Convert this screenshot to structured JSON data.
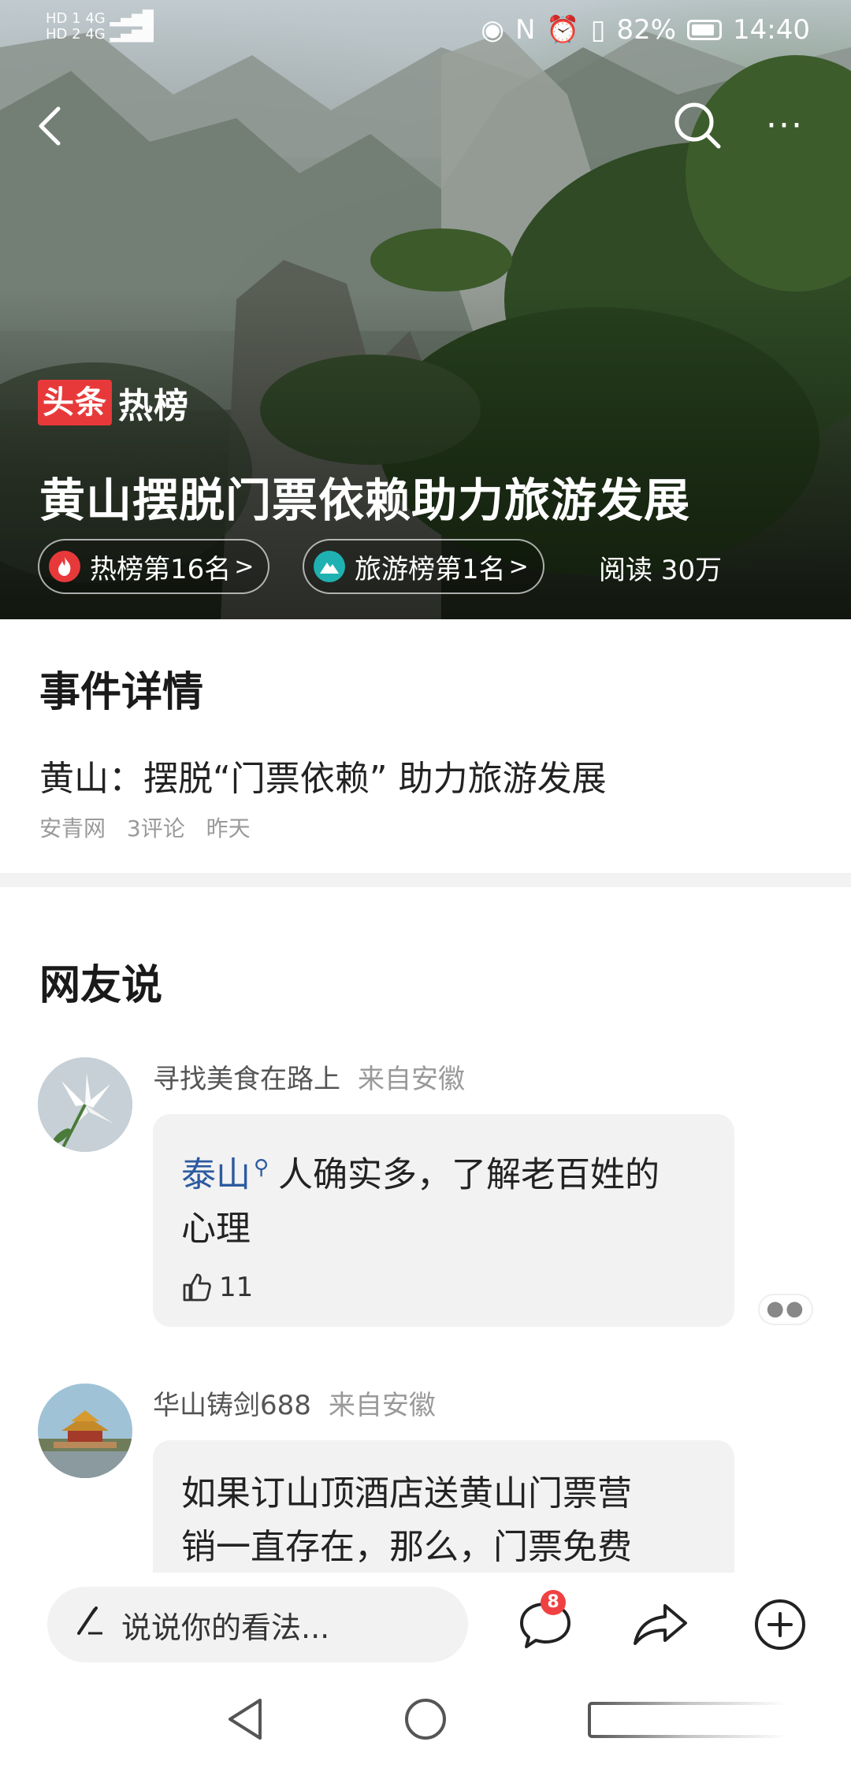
{
  "status_bar": {
    "left_lines": [
      "HD 1",
      "HD 2"
    ],
    "network": [
      "4G",
      "4G"
    ],
    "battery": "82%",
    "time": "14:40"
  },
  "top_bar": {
    "back_icon": "chevron-left-icon",
    "search_icon": "search-icon",
    "more_icon": "more-dots-icon",
    "more_label": "···"
  },
  "hero": {
    "brand_red": "头条",
    "brand_white": "热榜",
    "title": "黄山摆脱门票依赖助力旅游发展",
    "chips": [
      {
        "label": "热榜第16名",
        "arrow": ">",
        "icon": "fire-icon",
        "color": "#e8393a"
      },
      {
        "label": "旅游榜第1名",
        "arrow": ">",
        "icon": "mountain-icon",
        "color": "#1fb1b1"
      }
    ],
    "read_count": "阅读 30万"
  },
  "event": {
    "section_title": "事件详情",
    "headline": "黄山：摆脱“门票依赖” 助力旅游发展",
    "source": "安青网",
    "comments": "3评论",
    "time": "昨天"
  },
  "netizens": {
    "section_title": "网友说",
    "comments": [
      {
        "user": "寻找美食在路上",
        "location": "来自安徽",
        "keyword": "泰山",
        "text_line1": "人确实多，了解老百姓的",
        "text_line2": "心理",
        "likes": "11"
      },
      {
        "user": "华山铸剑688",
        "location": "来自安徽",
        "text_line1": "如果订山顶酒店送黄山门票营",
        "text_line2": "销一直存在，那么，门票免费"
      }
    ]
  },
  "action_bar": {
    "input_placeholder": "说说你的看法...",
    "comment_badge": "8",
    "icons": [
      "comment-icon",
      "share-icon",
      "add-icon"
    ]
  },
  "nav_bar": {
    "icons": [
      "nav-back-icon",
      "nav-home-icon",
      "nav-recent-icon"
    ]
  },
  "colors": {
    "brand_red": "#e8393a",
    "keyword_blue": "#2c5aa0",
    "badge_red": "#f04142",
    "teal": "#1fb1b1"
  }
}
